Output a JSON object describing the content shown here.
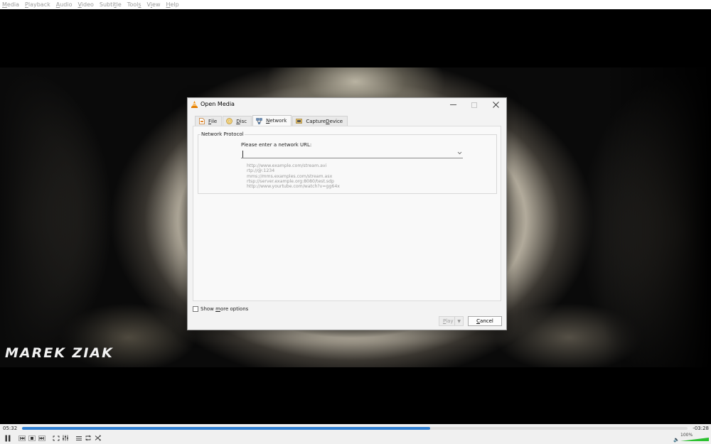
{
  "menubar": {
    "items": [
      {
        "pre": "",
        "mn": "M",
        "post": "edia"
      },
      {
        "pre": "",
        "mn": "P",
        "post": "layback"
      },
      {
        "pre": "",
        "mn": "A",
        "post": "udio"
      },
      {
        "pre": "",
        "mn": "V",
        "post": "ideo"
      },
      {
        "pre": "Subti",
        "mn": "t",
        "post": "le"
      },
      {
        "pre": "Tool",
        "mn": "s",
        "post": ""
      },
      {
        "pre": "V",
        "mn": "i",
        "post": "ew"
      },
      {
        "pre": "",
        "mn": "H",
        "post": "elp"
      }
    ]
  },
  "video": {
    "watermark": "MAREK ZIAK"
  },
  "dialog": {
    "title": "Open Media",
    "tabs": [
      {
        "pre": "",
        "mn": "F",
        "post": "ile"
      },
      {
        "pre": "",
        "mn": "D",
        "post": "isc"
      },
      {
        "pre": "",
        "mn": "N",
        "post": "etwork"
      },
      {
        "pre": "Capture ",
        "mn": "D",
        "post": "evice"
      }
    ],
    "group_title": "Network Protocol",
    "url_label": "Please enter a network URL:",
    "url_value": "",
    "examples": [
      "http://www.example.com/stream.avi",
      "rtp://@:1234",
      "mms://mms.examples.com/stream.asx",
      "rtsp://server.example.org:8080/test.sdp",
      "http://www.yourtube.com/watch?v=gg64x"
    ],
    "show_more": {
      "pre": "Show ",
      "mn": "m",
      "post": "ore options"
    },
    "play": {
      "pre": "",
      "mn": "P",
      "post": "lay"
    },
    "cancel": {
      "pre": "",
      "mn": "C",
      "post": "ancel"
    }
  },
  "player": {
    "time_elapsed": "05:32",
    "time_remaining": "-03:28",
    "progress_fraction": 0.613,
    "volume_label": "100%",
    "volume_fraction": 1.0
  },
  "colors": {
    "accent": "#2f7fd3",
    "volume_green": "#2bc130",
    "vlc_orange": "#f08a00"
  }
}
